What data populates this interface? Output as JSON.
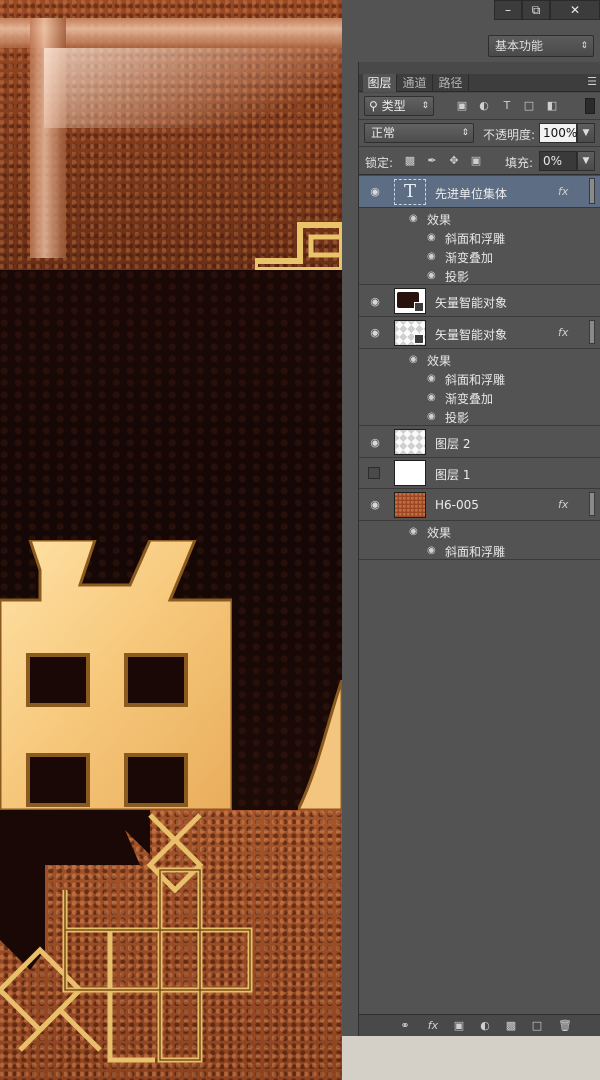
{
  "window": {
    "minimize_icon": "minus-icon",
    "restore_icon": "restore-icon",
    "close_icon": "close-icon",
    "workspace": "基本功能"
  },
  "panel": {
    "tabs": [
      {
        "label": "图层",
        "active": true
      },
      {
        "label": "通道",
        "active": false
      },
      {
        "label": "路径",
        "active": false
      }
    ],
    "filter_kind": "类型",
    "blend_mode": "正常",
    "opacity_label": "不透明度:",
    "opacity_value": "100%",
    "lock_label": "锁定:",
    "fill_label": "填充:",
    "fill_value": "0%",
    "accent_selected": "#5d6d84"
  },
  "layers": [
    {
      "name": "先进单位集体",
      "type": "text",
      "visible": true,
      "selected": true,
      "fx": "fx",
      "effects_label": "效果",
      "effects": [
        "斜面和浮雕",
        "渐变叠加",
        "投影"
      ]
    },
    {
      "name": "矢量智能对象",
      "type": "smart-object-dark",
      "visible": true,
      "selected": false
    },
    {
      "name": "矢量智能对象",
      "type": "smart-object",
      "visible": true,
      "selected": false,
      "fx": "fx",
      "effects_label": "效果",
      "effects": [
        "斜面和浮雕",
        "渐变叠加",
        "投影"
      ]
    },
    {
      "name": "图层 2",
      "type": "transparent",
      "visible": true,
      "selected": false
    },
    {
      "name": "图层 1",
      "type": "white",
      "visible": false,
      "selected": false
    },
    {
      "name": "H6-005",
      "type": "leather",
      "visible": true,
      "selected": false,
      "fx": "fx",
      "effects_label": "效果",
      "effects": [
        "斜面和浮雕"
      ]
    }
  ]
}
